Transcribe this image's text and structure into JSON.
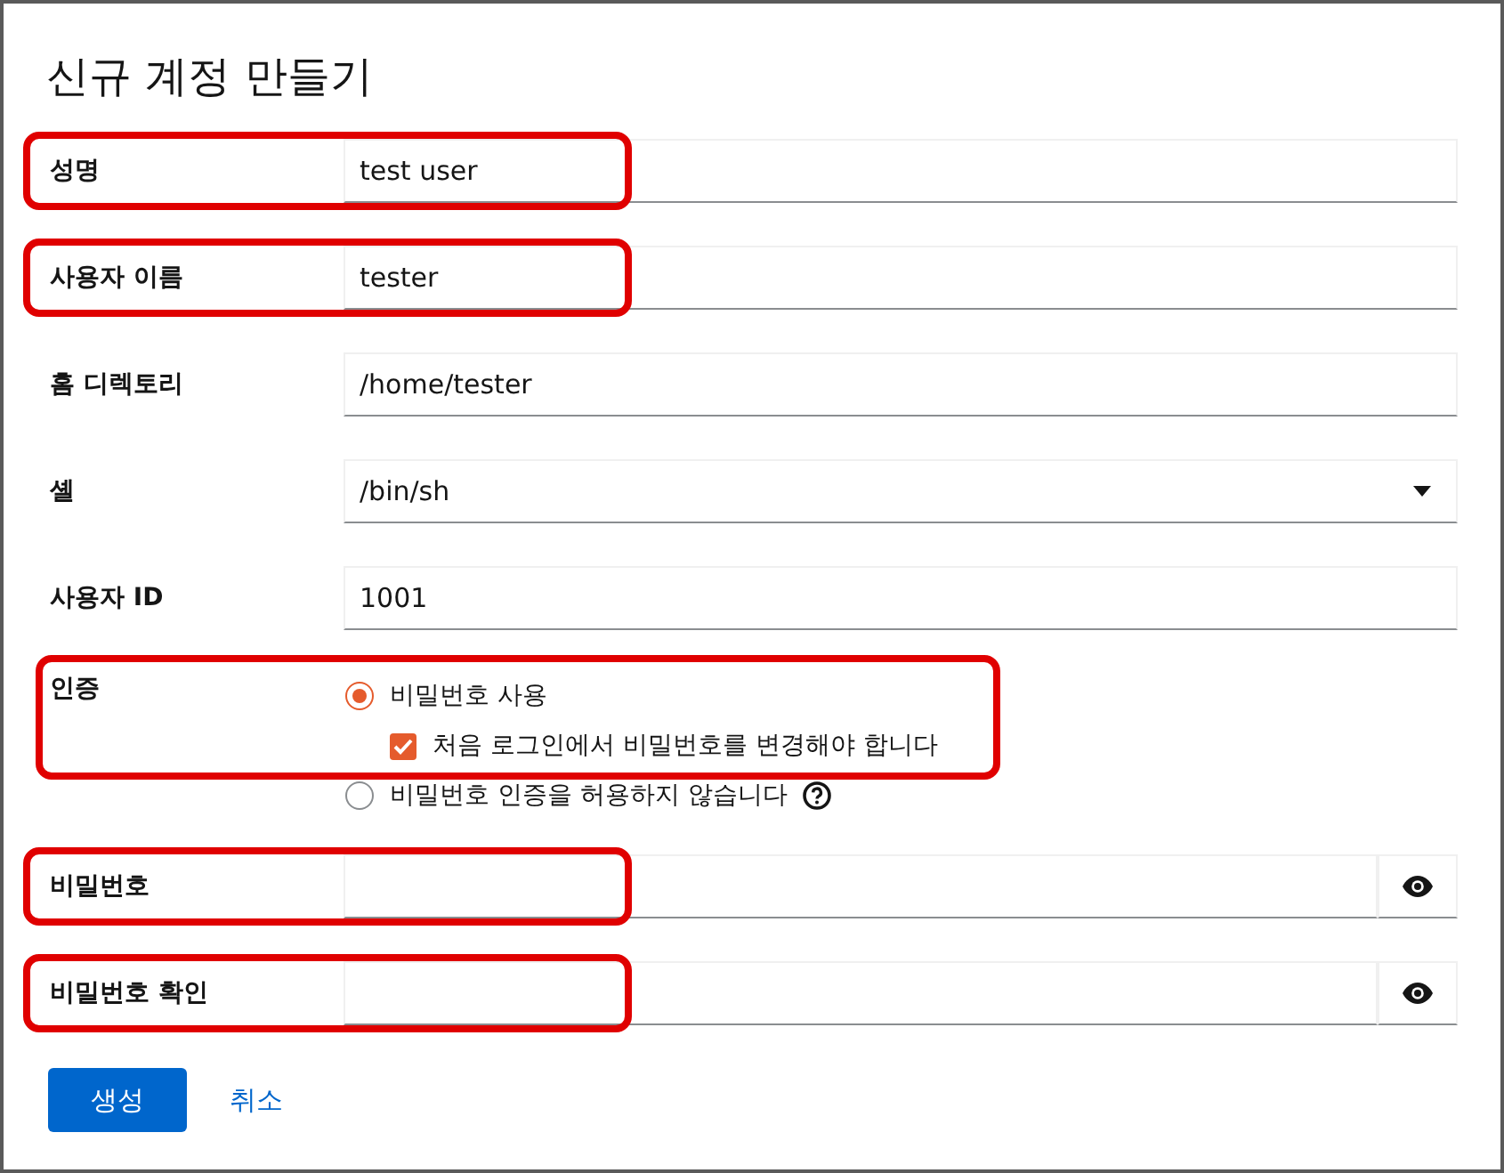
{
  "dialog": {
    "title": "신규 계정 만들기",
    "fields": [
      {
        "kind": "text",
        "label": "성명",
        "value": "test user",
        "highlighted": true
      },
      {
        "kind": "text",
        "label": "사용자 이름",
        "value": "tester",
        "highlighted": true
      },
      {
        "kind": "text",
        "label": "홈 디렉토리",
        "value": "/home/tester",
        "highlighted": false
      },
      {
        "kind": "select",
        "label": "셸",
        "value": "/bin/sh",
        "highlighted": false
      },
      {
        "kind": "text",
        "label": "사용자 ID",
        "value": "1001",
        "highlighted": false
      }
    ],
    "auth": {
      "label": "인증",
      "highlighted": true,
      "options": [
        {
          "label": "비밀번호 사용",
          "selected": true,
          "require_change": {
            "label": "처음 로그인에서 비밀번호를 변경해야 합니다",
            "checked": true
          }
        },
        {
          "label": "비밀번호 인증을 허용하지 않습니다",
          "selected": false,
          "help": true
        }
      ]
    },
    "password_fields": [
      {
        "kind": "password",
        "label": "비밀번호",
        "highlighted": true
      },
      {
        "kind": "password",
        "label": "비밀번호 확인",
        "highlighted": true
      }
    ],
    "buttons": [
      {
        "kind": "primary",
        "label": "생성"
      },
      {
        "kind": "link",
        "label": "취소"
      }
    ]
  }
}
